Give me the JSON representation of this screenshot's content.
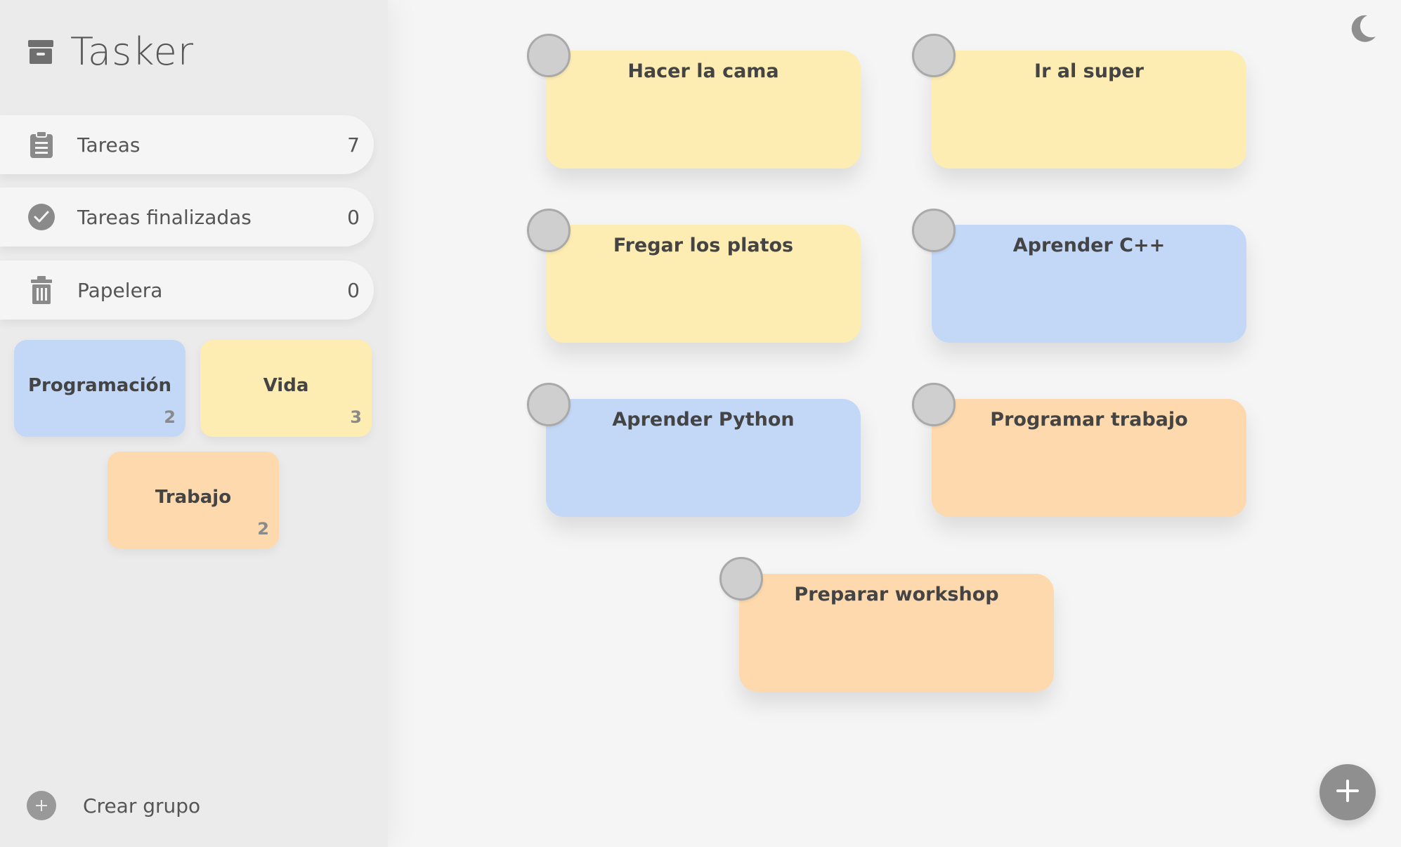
{
  "app": {
    "title": "Tasker"
  },
  "nav": [
    {
      "label": "Tareas",
      "count": "7",
      "icon": "clipboard-icon"
    },
    {
      "label": "Tareas finalizadas",
      "count": "0",
      "icon": "check-circle-icon"
    },
    {
      "label": "Papelera",
      "count": "0",
      "icon": "trash-icon"
    }
  ],
  "groups": [
    {
      "name": "Programación",
      "count": "2",
      "color": "#c3d7f7"
    },
    {
      "name": "Vida",
      "count": "3",
      "color": "#fdedb3"
    },
    {
      "name": "Trabajo",
      "count": "2",
      "color": "#fdd9ad"
    }
  ],
  "create_group": {
    "label": "Crear grupo"
  },
  "tasks": [
    {
      "title": "Hacer la cama",
      "group": "Vida",
      "color": "#fdedb3"
    },
    {
      "title": "Ir al super",
      "group": "Vida",
      "color": "#fdedb3"
    },
    {
      "title": "Fregar los platos",
      "group": "Vida",
      "color": "#fdedb3"
    },
    {
      "title": "Aprender C++",
      "group": "Programación",
      "color": "#c3d7f7"
    },
    {
      "title": "Aprender Python",
      "group": "Programación",
      "color": "#c3d7f7"
    },
    {
      "title": "Programar trabajo",
      "group": "Trabajo",
      "color": "#fdd9ad"
    },
    {
      "title": "Preparar workshop",
      "group": "Trabajo",
      "color": "#fdd9ad"
    }
  ],
  "icons": {
    "theme_toggle": "moon-icon",
    "add_task": "plus-icon",
    "brand": "archive-box-icon"
  }
}
